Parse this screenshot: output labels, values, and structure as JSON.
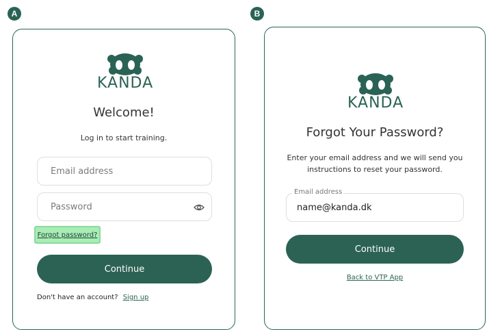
{
  "panel_a": {
    "badge": "A",
    "brand": "KANDA",
    "title": "Welcome!",
    "subtitle": "Log in to start training.",
    "email_placeholder": "Email address",
    "password_placeholder": "Password",
    "forgot_link": "Forgot password?",
    "continue_label": "Continue",
    "no_account_text": "Don't have an account?",
    "signup_link": "Sign up"
  },
  "panel_b": {
    "badge": "B",
    "brand": "KANDA",
    "title": "Forgot Your Password?",
    "subtitle_line1": "Enter your email address and we will send you",
    "subtitle_line2": "instructions to reset your password.",
    "email_label": "Email address",
    "email_value": "name@kanda.dk",
    "continue_label": "Continue",
    "back_link": "Back to VTP App"
  },
  "colors": {
    "brand": "#2a6355",
    "button": "#2c6253",
    "highlight": "#a9edb6"
  },
  "icons": {
    "logo": "panda-icon",
    "password_toggle": "eye-icon"
  }
}
